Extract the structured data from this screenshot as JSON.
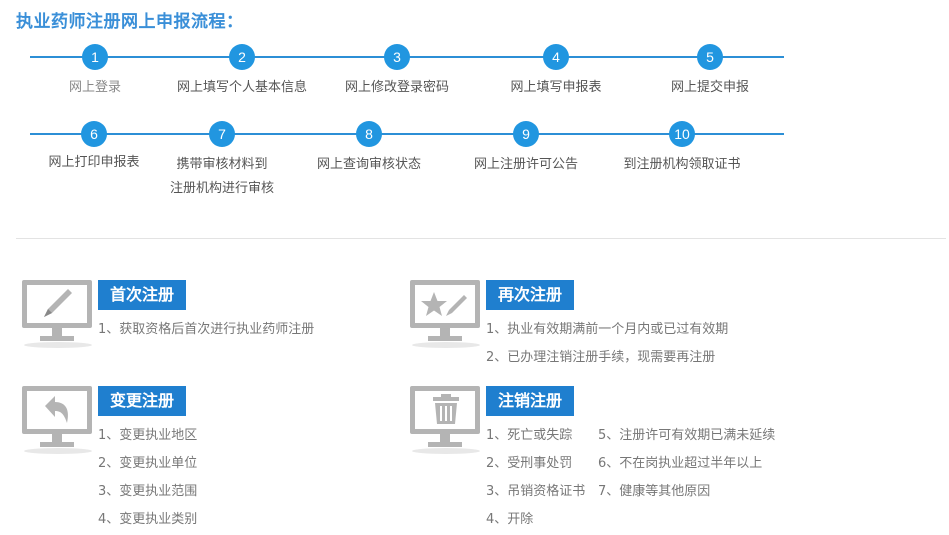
{
  "page_title": "执业药师注册网上申报流程：",
  "flow": {
    "row1": [
      {
        "num": "1",
        "label": "网上登录"
      },
      {
        "num": "2",
        "label": "网上填写个人基本信息"
      },
      {
        "num": "3",
        "label": "网上修改登录密码"
      },
      {
        "num": "4",
        "label": "网上填写申报表"
      },
      {
        "num": "5",
        "label": "网上提交申报"
      }
    ],
    "row2": [
      {
        "num": "6",
        "label": "网上打印申报表"
      },
      {
        "num": "7",
        "label": "携带审核材料到",
        "label2": "注册机构进行审核"
      },
      {
        "num": "8",
        "label": "网上查询审核状态"
      },
      {
        "num": "9",
        "label": "网上注册许可公告"
      },
      {
        "num": "10",
        "label": "到注册机构领取证书"
      }
    ]
  },
  "cards": {
    "first": {
      "icon": "pen-monitor-icon",
      "title": "首次注册",
      "items": [
        "1、获取资格后首次进行执业药师注册"
      ]
    },
    "again": {
      "icon": "star-pen-monitor-icon",
      "title": "再次注册",
      "items": [
        "1、执业有效期满前一个月内或已过有效期",
        "2、已办理注销注册手续，现需要再注册"
      ]
    },
    "change": {
      "icon": "undo-arrow-monitor-icon",
      "title": "变更注册",
      "items": [
        "1、变更执业地区",
        "2、变更执业单位",
        "3、变更执业范围",
        "4、变更执业类别"
      ]
    },
    "cancel": {
      "icon": "trash-monitor-icon",
      "title": "注销注册",
      "col1": [
        "1、死亡或失踪",
        "2、受刑事处罚",
        "3、吊销资格证书",
        "4、开除"
      ],
      "col2": [
        "5、注册许可有效期已满未延续",
        "6、不在岗执业超过半年以上",
        "7、健康等其他原因"
      ]
    }
  },
  "colors": {
    "accent": "#2196e0",
    "title": "#3a8fd8",
    "badge": "#1f7fcf",
    "monitor": "#b4b4b4"
  }
}
